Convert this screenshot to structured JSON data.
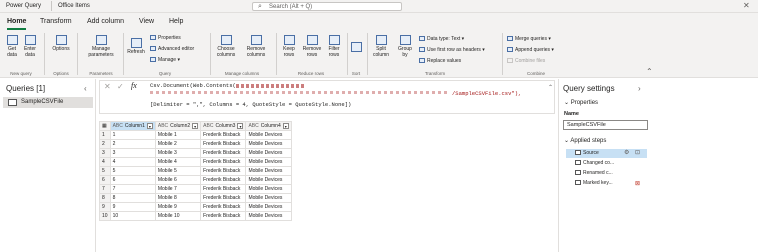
{
  "titlebar": {
    "app_name": "Power Query",
    "workspace": "Office Items",
    "search_placeholder": "Search (Alt + Q)",
    "close_glyph": "✕"
  },
  "tabs": [
    "Home",
    "Transform",
    "Add column",
    "View",
    "Help"
  ],
  "ribbon": {
    "get_data": "Get data",
    "enter_data": "Enter data",
    "options": "Options",
    "manage_parameters": "Manage parameters",
    "refresh": "Refresh",
    "properties": "Properties",
    "advanced_editor": "Advanced editor",
    "manage": "Manage",
    "choose_columns": "Choose columns",
    "remove_columns": "Remove columns",
    "keep_rows": "Keep rows",
    "remove_rows": "Remove rows",
    "filter_rows": "Filter rows",
    "split_column": "Split column",
    "group_by": "Group by",
    "data_type": "Data type: Text",
    "use_first_row": "Use first row as headers",
    "replace_values": "Replace values",
    "merge_queries": "Merge queries",
    "append_queries": "Append queries",
    "combine_files": "Combine files",
    "groups": {
      "new_query": "New query",
      "options": "Options",
      "parameters": "Parameters",
      "query": "Query",
      "manage_columns": "Manage columns",
      "reduce_rows": "Reduce rows",
      "sort": "Sort",
      "transform": "Transform",
      "combine": "Combine"
    }
  },
  "queries": {
    "title": "Queries [1]",
    "items": [
      "SampleCSVFile"
    ]
  },
  "formula": {
    "line1_prefix": "Csv.Document(Web.Contents(",
    "line2_suffix": "/SampleCSVFile.csv\"),",
    "line3": "[Delimiter = \",\", Columns = 4, QuoteStyle = QuoteStyle.None])"
  },
  "grid": {
    "columns": [
      {
        "type": "ABC",
        "name": "Column1"
      },
      {
        "type": "ABC",
        "name": "Column2"
      },
      {
        "type": "ABC",
        "name": "Column3"
      },
      {
        "type": "ABC",
        "name": "Column4"
      }
    ],
    "rows": [
      [
        "1",
        "1",
        "Mobile 1",
        "Frederik Bisback",
        "Mobile Devices"
      ],
      [
        "2",
        "2",
        "Mobile 2",
        "Frederik Bisback",
        "Mobile Devices"
      ],
      [
        "3",
        "3",
        "Mobile 3",
        "Frederik Bisback",
        "Mobile Devices"
      ],
      [
        "4",
        "4",
        "Mobile 4",
        "Frederik Bisback",
        "Mobile Devices"
      ],
      [
        "5",
        "5",
        "Mobile 5",
        "Frederik Bisback",
        "Mobile Devices"
      ],
      [
        "6",
        "6",
        "Mobile 6",
        "Frederik Bisback",
        "Mobile Devices"
      ],
      [
        "7",
        "7",
        "Mobile 7",
        "Frederik Bisback",
        "Mobile Devices"
      ],
      [
        "8",
        "8",
        "Mobile 8",
        "Frederik Bisback",
        "Mobile Devices"
      ],
      [
        "9",
        "9",
        "Mobile 9",
        "Frederik Bisback",
        "Mobile Devices"
      ],
      [
        "10",
        "10",
        "Mobile 10",
        "Frederik Bisback",
        "Mobile Devices"
      ]
    ]
  },
  "settings": {
    "title": "Query settings",
    "properties": "Properties",
    "name_label": "Name",
    "name_value": "SampleCSVFile",
    "applied_steps": "Applied steps",
    "steps": [
      "Source",
      "Changed co...",
      "Renamed c...",
      "Marked key..."
    ]
  },
  "colors": {
    "accent": "#107c41",
    "selected": "#c7e0f4"
  }
}
